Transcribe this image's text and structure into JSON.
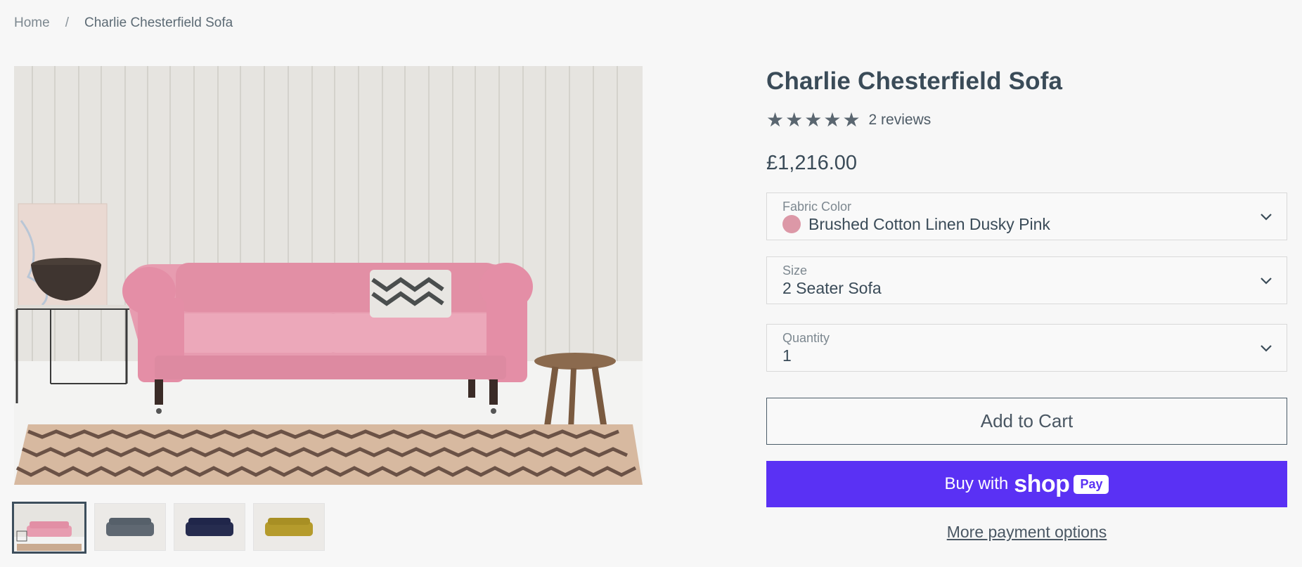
{
  "breadcrumb": {
    "home": "Home",
    "separator": "/",
    "current": "Charlie Chesterfield Sofa"
  },
  "product": {
    "title": "Charlie Chesterfield Sofa",
    "rating_stars": 5,
    "reviews_label": "2 reviews",
    "price": "£1,216.00"
  },
  "options": {
    "fabric_color": {
      "label": "Fabric Color",
      "value": "Brushed Cotton Linen Dusky Pink",
      "swatch_color": "#dc98a7"
    },
    "size": {
      "label": "Size",
      "value": "2 Seater Sofa"
    },
    "quantity": {
      "label": "Quantity",
      "value": "1"
    }
  },
  "actions": {
    "add_to_cart": "Add to Cart",
    "buy_with": "Buy with",
    "shop_logo": "shop",
    "pay_logo": "Pay",
    "more_payment": "More payment options"
  },
  "gallery": {
    "thumbnails": [
      {
        "icon": "sofa-pink-thumbnail",
        "color": "#e79cb0",
        "active": true
      },
      {
        "icon": "sofa-grey-thumbnail",
        "color": "#5f6872",
        "active": false
      },
      {
        "icon": "sofa-navy-thumbnail",
        "color": "#262c4f",
        "active": false
      },
      {
        "icon": "sofa-mustard-thumbnail",
        "color": "#b59b2c",
        "active": false
      }
    ]
  },
  "colors": {
    "accent": "#5a31f4",
    "text": "#3a4b58",
    "background": "#f7f7f7"
  }
}
